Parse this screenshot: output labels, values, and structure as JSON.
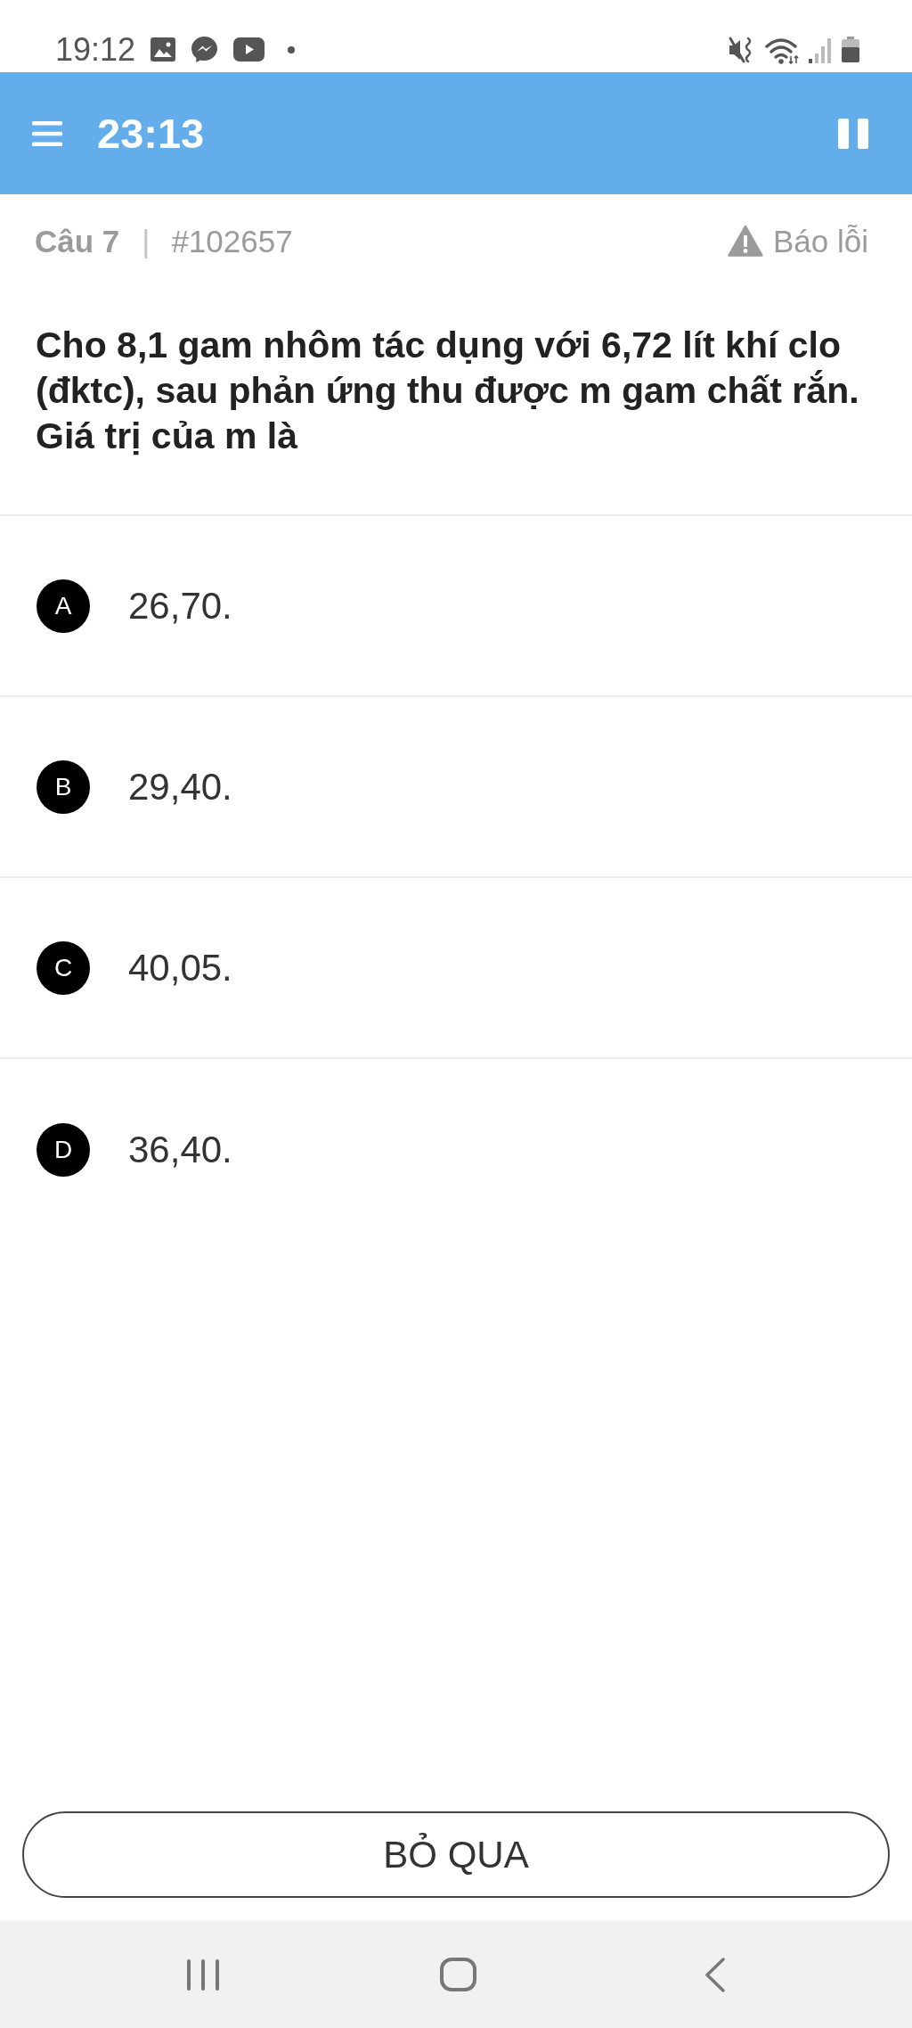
{
  "status_bar": {
    "time": "19:12"
  },
  "header": {
    "timer": "23:13"
  },
  "question": {
    "number": "Câu 7",
    "separator": "|",
    "id": "#102657",
    "report_label": "Báo lỗi",
    "text": "Cho 8,1 gam nhôm tác dụng với 6,72 lít khí clo (đktc), sau phản ứng thu được m gam chất rắn. Giá trị của m là"
  },
  "options": [
    {
      "letter": "A",
      "text": "26,70.",
      "selected": false
    },
    {
      "letter": "B",
      "text": "29,40.",
      "selected": false
    },
    {
      "letter": "C",
      "text": "40,05.",
      "selected": false
    },
    {
      "letter": "D",
      "text": "36,40.",
      "selected": false
    }
  ],
  "skip_button": {
    "label": "BỎ QUA"
  }
}
